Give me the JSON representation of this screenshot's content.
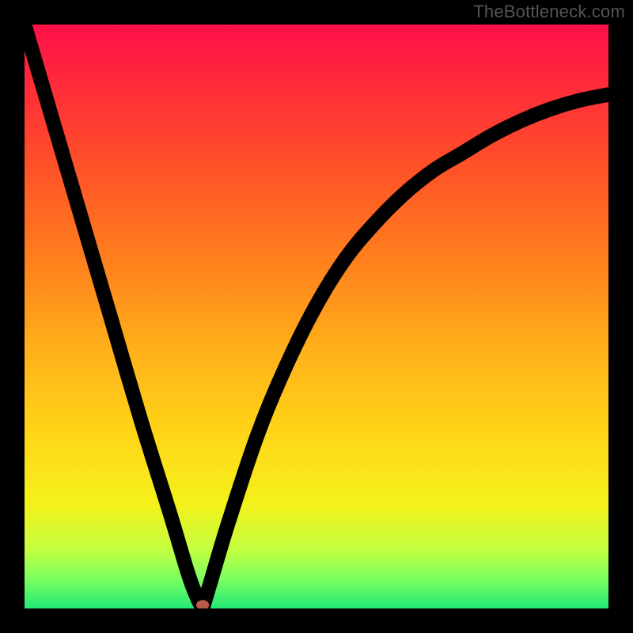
{
  "watermark": "TheBottleneck.com",
  "colors": {
    "frame": "#000000",
    "gradient_stops": [
      {
        "offset": 0.0,
        "color": "#ff1049"
      },
      {
        "offset": 0.1,
        "color": "#ff2a3a"
      },
      {
        "offset": 0.25,
        "color": "#ff5327"
      },
      {
        "offset": 0.4,
        "color": "#ff7e1d"
      },
      {
        "offset": 0.55,
        "color": "#ffae1a"
      },
      {
        "offset": 0.7,
        "color": "#ffd518"
      },
      {
        "offset": 0.82,
        "color": "#f5f11b"
      },
      {
        "offset": 0.9,
        "color": "#c2ff40"
      },
      {
        "offset": 0.95,
        "color": "#7aff60"
      },
      {
        "offset": 1.0,
        "color": "#22e977"
      }
    ],
    "curve": "#000000",
    "marker": "#b95a4a"
  },
  "chart_data": {
    "type": "line",
    "title": "",
    "xlabel": "",
    "ylabel": "",
    "xlim": [
      0,
      100
    ],
    "ylim": [
      0,
      100
    ],
    "marker": {
      "x": 30.5,
      "y": 0
    },
    "left_branch": {
      "x": [
        0,
        5,
        10,
        15,
        20,
        25,
        28,
        29.5,
        30.5
      ],
      "y": [
        100,
        83,
        66,
        49,
        32,
        16,
        6,
        2,
        0
      ]
    },
    "right_branch": {
      "x": [
        30.5,
        32,
        35,
        40,
        45,
        50,
        55,
        60,
        65,
        70,
        75,
        80,
        85,
        90,
        95,
        100
      ],
      "y": [
        0,
        5,
        15,
        30,
        42,
        52,
        60,
        66,
        71,
        75,
        78,
        81,
        83.5,
        85.5,
        87,
        88
      ]
    }
  }
}
